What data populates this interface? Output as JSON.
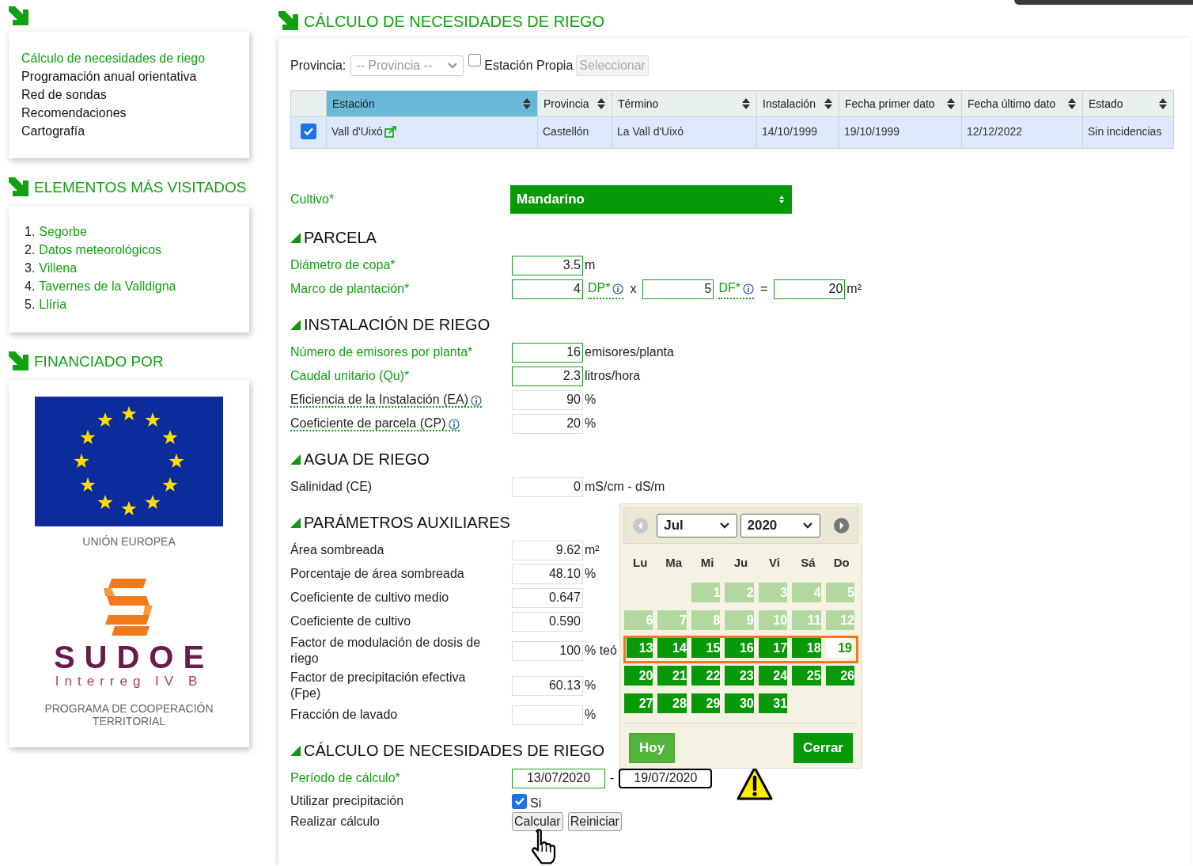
{
  "sidebar": {
    "menu": [
      {
        "label": "Cálculo de necesidades de riego",
        "selected": true
      },
      {
        "label": "Programación anual orientativa",
        "selected": false
      },
      {
        "label": "Red de sondas",
        "selected": false
      },
      {
        "label": "Recomendaciones",
        "selected": false
      },
      {
        "label": "Cartografía",
        "selected": false
      }
    ],
    "visited": {
      "title": "ELEMENTOS MÁS VISITADOS",
      "items": [
        {
          "number": "1.",
          "label": "Segorbe"
        },
        {
          "number": "2.",
          "label": "Datos meteorológicos"
        },
        {
          "number": "3.",
          "label": "Villena"
        },
        {
          "number": "4.",
          "label": "Tavernes de la Valldigna"
        },
        {
          "number": "5.",
          "label": "Llíria"
        }
      ]
    },
    "funding": {
      "title": "FINANCIADO POR",
      "eu_caption": "UNIÓN EUROPEA",
      "sudoe_name": "SUDOE",
      "sudoe_subtitle": "Interreg IV B",
      "sudoe_caption": "PROGRAMA DE COOPERACIÓN TERRITORIAL"
    }
  },
  "main": {
    "title": "CÁLCULO DE NECESIDADES DE RIEGO",
    "filter": {
      "label": "Provincia:",
      "select_placeholder": "-- Provincia --",
      "own_station": {
        "label": "Estación Propia",
        "checked": false
      },
      "select_button": {
        "label": "Seleccionar",
        "disabled": true
      }
    },
    "stations_table": {
      "columns": [
        {
          "label": "Estación",
          "selected": true
        },
        {
          "label": "Provincia",
          "selected": false
        },
        {
          "label": "Término",
          "selected": false
        },
        {
          "label": "Instalación",
          "selected": false
        },
        {
          "label": "Fecha primer dato",
          "selected": false
        },
        {
          "label": "Fecha último dato",
          "selected": false
        },
        {
          "label": "Estado",
          "selected": false
        }
      ],
      "rows": [
        {
          "checked": true,
          "cells": [
            "Vall d'Uixó",
            "Castellón",
            "La Vall d'Uixó",
            "14/10/1999",
            "19/10/1999",
            "12/12/2022",
            "Sin incidencias"
          ]
        }
      ]
    },
    "crop": {
      "label": "Cultivo*",
      "value": "Mandarino"
    },
    "sections": [
      {
        "title": "PARCELA",
        "rows": [
          {
            "kind": "input",
            "label": "Diámetro de copa*",
            "required": true,
            "info": false,
            "value": "3.5",
            "unit": "m"
          },
          {
            "kind": "frame",
            "label": "Marco de plantación*",
            "required": true,
            "parts": [
              {
                "value": "4",
                "label": "DP*"
              },
              {
                "value": "5",
                "label": "DF*"
              }
            ],
            "operator": "x",
            "equals": "=",
            "result": "20",
            "unit": "m²"
          }
        ]
      },
      {
        "title": "INSTALACIÓN DE RIEGO",
        "rows": [
          {
            "kind": "input",
            "label": "Número de emisores por planta*",
            "required": true,
            "info": false,
            "value": "16",
            "unit": "emisores/planta"
          },
          {
            "kind": "input",
            "label": "Caudal unitario (Qu)*",
            "required": true,
            "info": false,
            "value": "2.3",
            "unit": "litros/hora"
          },
          {
            "kind": "input",
            "label": "Eficiencia de la Instalación (EA)",
            "required": false,
            "info": true,
            "value": "90",
            "unit": "%"
          },
          {
            "kind": "input",
            "label": "Coeficiente de parcela (CP)",
            "required": false,
            "info": true,
            "value": "20",
            "unit": "%"
          }
        ]
      },
      {
        "title": "AGUA DE RIEGO",
        "rows": [
          {
            "kind": "input",
            "label": "Salinidad (CE)",
            "required": false,
            "info": false,
            "value": "0",
            "unit": "mS/cm - dS/m"
          }
        ]
      },
      {
        "title": "PARÁMETROS AUXILIARES",
        "rows": [
          {
            "kind": "input",
            "label": "Área sombreada",
            "required": false,
            "info": false,
            "value": "9.62",
            "unit": "m²"
          },
          {
            "kind": "input",
            "label": "Porcentaje de área sombreada",
            "required": false,
            "info": false,
            "value": "48.10",
            "unit": "%"
          },
          {
            "kind": "input",
            "label": "Coeficiente de cultivo medio",
            "required": false,
            "info": false,
            "value": "0.647"
          },
          {
            "kind": "input",
            "label": "Coeficiente de cultivo",
            "required": false,
            "info": false,
            "value": "0.590"
          },
          {
            "kind": "input",
            "label": "Factor de modulación de dosis de riego",
            "required": false,
            "info": false,
            "value": "100",
            "unit": "% teó"
          },
          {
            "kind": "input",
            "label": "Factor de precipitación efectiva (Fpe)",
            "required": false,
            "info": false,
            "value": "60.13",
            "unit": "%"
          },
          {
            "kind": "input",
            "label": "Fracción de lavado",
            "required": false,
            "info": false,
            "unit": "%"
          }
        ]
      },
      {
        "title": "CÁLCULO DE NECESIDADES DE RIEGO",
        "rows": [
          {
            "kind": "period",
            "label": "Período de cálculo*",
            "required": true,
            "from": "13/07/2020",
            "separator": "-",
            "to": "19/07/2020",
            "focused": true
          },
          {
            "kind": "checkbox",
            "label": "Utilizar precipitación",
            "required": false,
            "checked": true,
            "text": "Si"
          },
          {
            "kind": "buttons",
            "label": "Realizar cálculo",
            "required": false,
            "buttons": [
              "Calcular",
              "Reiniciar"
            ]
          }
        ]
      }
    ]
  },
  "calendar": {
    "month": "Jul",
    "year": "2020",
    "weekdays": [
      "Lu",
      "Ma",
      "Mi",
      "Ju",
      "Vi",
      "Sá",
      "Do"
    ],
    "days": [
      {
        "kind": "blank"
      },
      {
        "kind": "blank"
      },
      {
        "kind": "past",
        "label": "1",
        "selected": false
      },
      {
        "kind": "past",
        "label": "2",
        "selected": false
      },
      {
        "kind": "past",
        "label": "3",
        "selected": false
      },
      {
        "kind": "past",
        "label": "4",
        "selected": false
      },
      {
        "kind": "past",
        "label": "5",
        "selected": false
      },
      {
        "kind": "past",
        "label": "6",
        "selected": false
      },
      {
        "kind": "past",
        "label": "7",
        "selected": false
      },
      {
        "kind": "past",
        "label": "8",
        "selected": false
      },
      {
        "kind": "past",
        "label": "9",
        "selected": false
      },
      {
        "kind": "past",
        "label": "10",
        "selected": false
      },
      {
        "kind": "past",
        "label": "11",
        "selected": false
      },
      {
        "kind": "past",
        "label": "12",
        "selected": false
      },
      {
        "kind": "available",
        "label": "13",
        "selected": true
      },
      {
        "kind": "available",
        "label": "14",
        "selected": true
      },
      {
        "kind": "available",
        "label": "15",
        "selected": true
      },
      {
        "kind": "available",
        "label": "16",
        "selected": true
      },
      {
        "kind": "available",
        "label": "17",
        "selected": true
      },
      {
        "kind": "available",
        "label": "18",
        "selected": true
      },
      {
        "kind": "current",
        "label": "19",
        "selected": true
      },
      {
        "kind": "available",
        "label": "20",
        "selected": false
      },
      {
        "kind": "available",
        "label": "21",
        "selected": false
      },
      {
        "kind": "available",
        "label": "22",
        "selected": false
      },
      {
        "kind": "available",
        "label": "23",
        "selected": false
      },
      {
        "kind": "available",
        "label": "24",
        "selected": false
      },
      {
        "kind": "available",
        "label": "25",
        "selected": false
      },
      {
        "kind": "available",
        "label": "26",
        "selected": false
      },
      {
        "kind": "available",
        "label": "27",
        "selected": false
      },
      {
        "kind": "available",
        "label": "28",
        "selected": false
      },
      {
        "kind": "available",
        "label": "29",
        "selected": false
      },
      {
        "kind": "available",
        "label": "30",
        "selected": false
      },
      {
        "kind": "available",
        "label": "31",
        "selected": false
      }
    ],
    "today_button": "Hoy",
    "close_button": "Cerrar"
  }
}
